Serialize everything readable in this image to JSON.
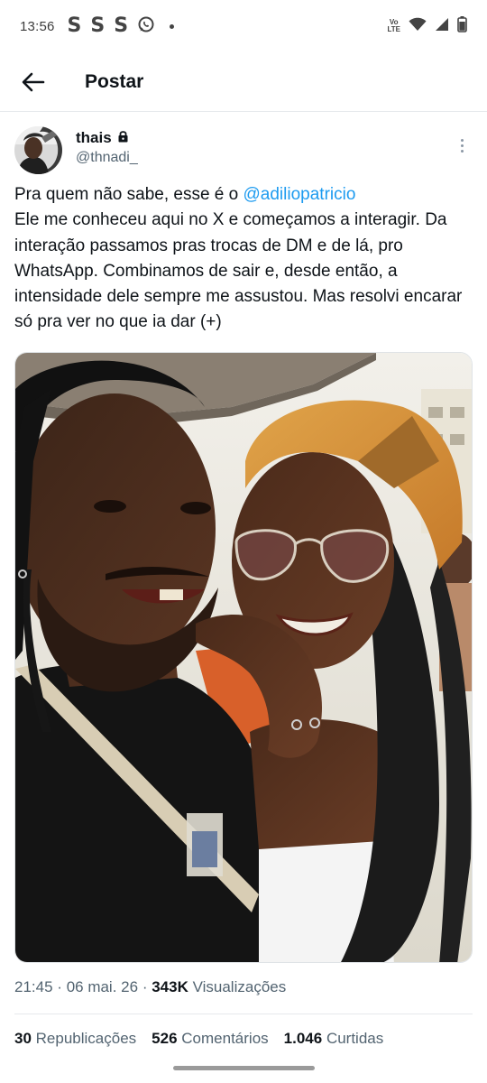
{
  "status_bar": {
    "time": "13:56",
    "app_icons": [
      "S",
      "S",
      "S"
    ],
    "volte_top": "Vo",
    "volte_bottom": "LTE"
  },
  "header": {
    "title": "Postar",
    "back_icon": "arrow-left-icon"
  },
  "post": {
    "author_name": "thais",
    "author_handle": "@thnadi_",
    "lock_icon": "lock-icon",
    "text_before_mention": "Pra quem não sabe, esse é o ",
    "mention": "@adiliopatricio",
    "text_after_mention": "Ele me conheceu aqui no X e começamos a interagir. Da interação passamos pras trocas de DM e de lá, pro WhatsApp. Combinamos de sair e, desde então, a intensidade dele sempre me assustou. Mas resolvi encarar só pra ver no que ia dar (+)",
    "time": "21:45",
    "date": "06 mai. 26",
    "separator": "·",
    "views_count": "343K",
    "views_label": "Visualizações"
  },
  "stats": [
    {
      "count": "30",
      "label": "Republicações"
    },
    {
      "count": "526",
      "label": "Comentários"
    },
    {
      "count": "1.046",
      "label": "Curtidas"
    }
  ],
  "colors": {
    "accent": "#1d9bf0",
    "text": "#0f1419",
    "secondary": "#536471",
    "divider": "#e6e9ec"
  }
}
